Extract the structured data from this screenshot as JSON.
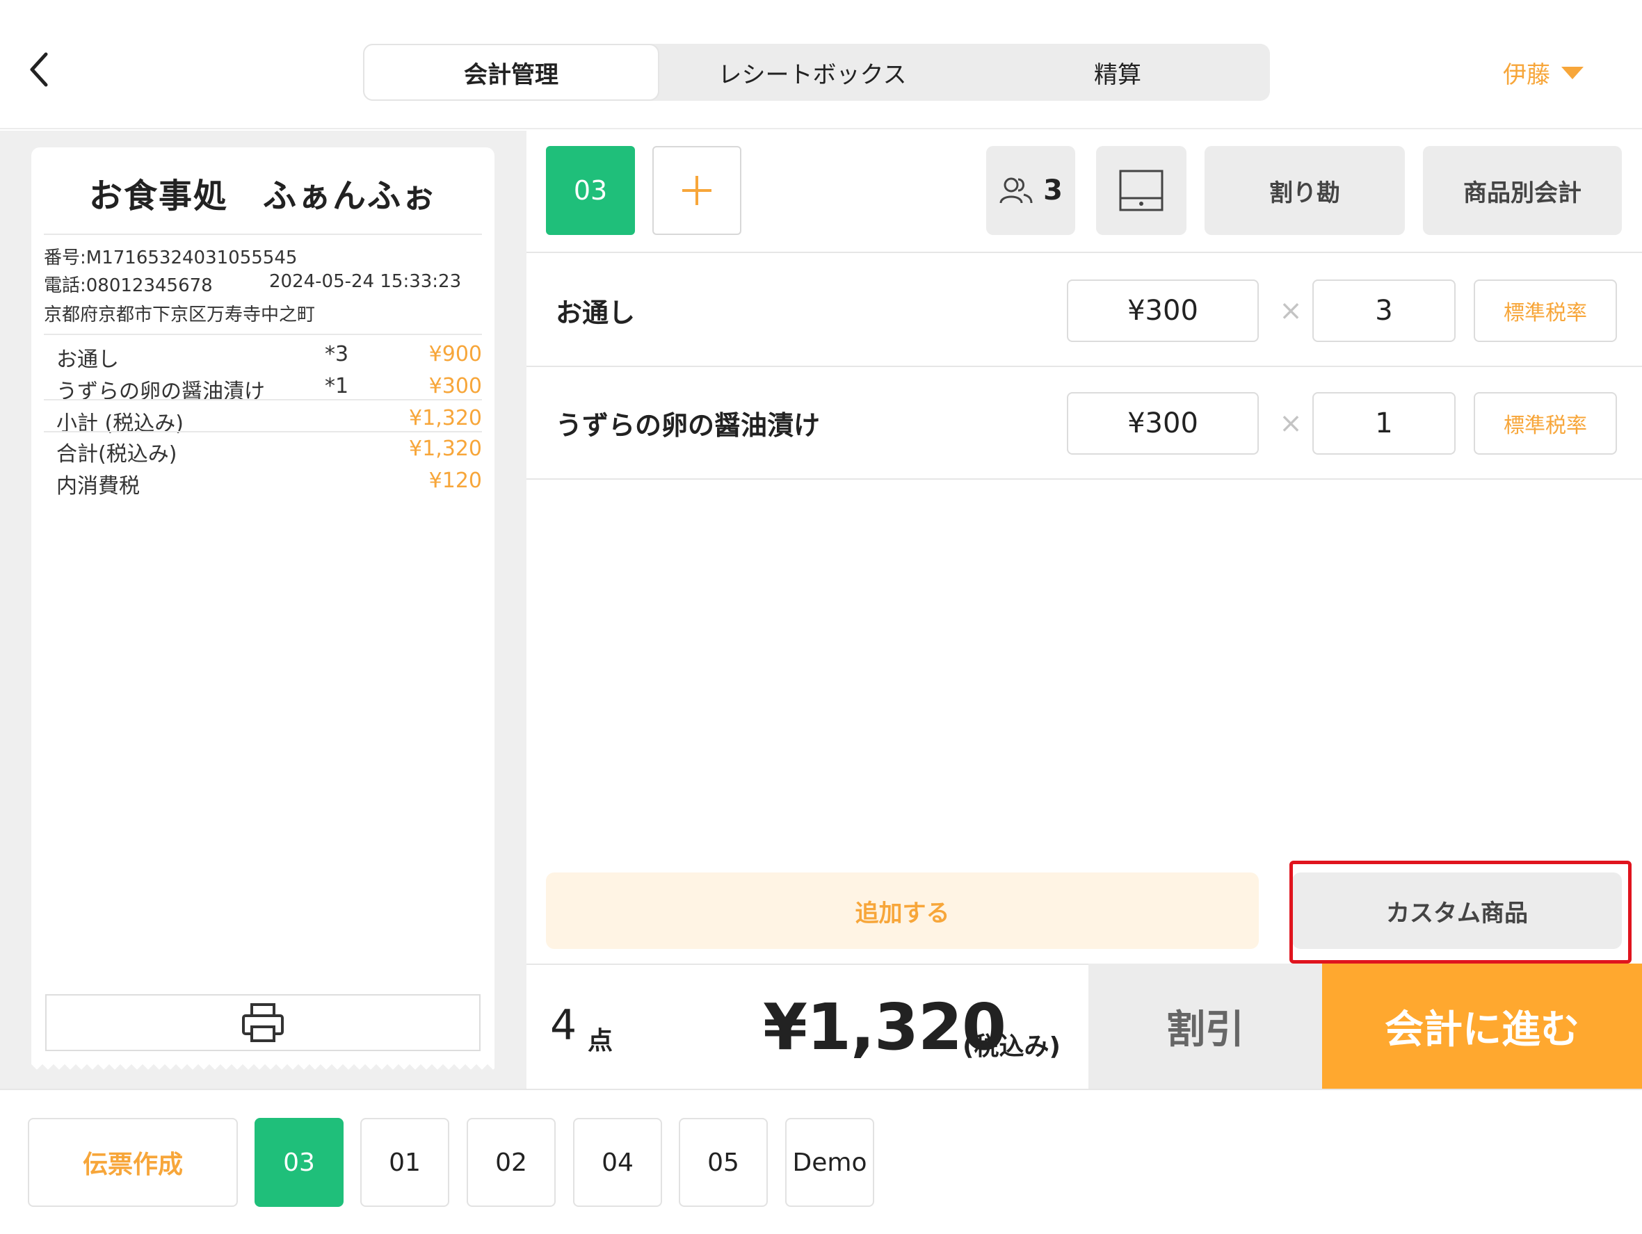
{
  "header": {
    "tabs": [
      "会計管理",
      "レシートボックス",
      "精算"
    ],
    "user": "伊藤"
  },
  "receipt": {
    "store_name": "お食事処　ふぁんふぉ",
    "number": "番号:M17165324031055545",
    "phone": "電話:08012345678",
    "datetime": "2024-05-24 15:33:23",
    "address": "京都府京都市下京区万寿寺中之町",
    "items": [
      {
        "name": "お通し",
        "qty": "*3",
        "price": "¥900"
      },
      {
        "name": "うずらの卵の醤油漬け",
        "qty": "*1",
        "price": "¥300"
      }
    ],
    "subtotal_label": "小計 (税込み)",
    "subtotal": "¥1,320",
    "total_label": "合計(税込み)",
    "total": "¥1,320",
    "tax_label": "内消費税",
    "tax": "¥120"
  },
  "order": {
    "current_tag": "03",
    "people_count": "3",
    "split_label": "割り勘",
    "by_item_label": "商品別会計",
    "lines": [
      {
        "name": "お通し",
        "price": "¥300",
        "qty": "3",
        "tax": "標準税率"
      },
      {
        "name": "うずらの卵の醤油漬け",
        "price": "¥300",
        "qty": "1",
        "tax": "標準税率"
      }
    ],
    "times_symbol": "×",
    "add_label": "追加する",
    "custom_label": "カスタム商品"
  },
  "summary": {
    "count": "4",
    "count_unit": "点",
    "total": "¥1,320",
    "total_suffix": "(税込み)",
    "discount_label": "割引",
    "checkout_label": "会計に進む"
  },
  "footer": {
    "slip_label": "伝票作成",
    "tabs": [
      "03",
      "01",
      "02",
      "04",
      "05",
      "Demo"
    ]
  },
  "colors": {
    "accent": "#f7a63a",
    "green": "#1fbf7a",
    "highlight": "#e0141e"
  }
}
